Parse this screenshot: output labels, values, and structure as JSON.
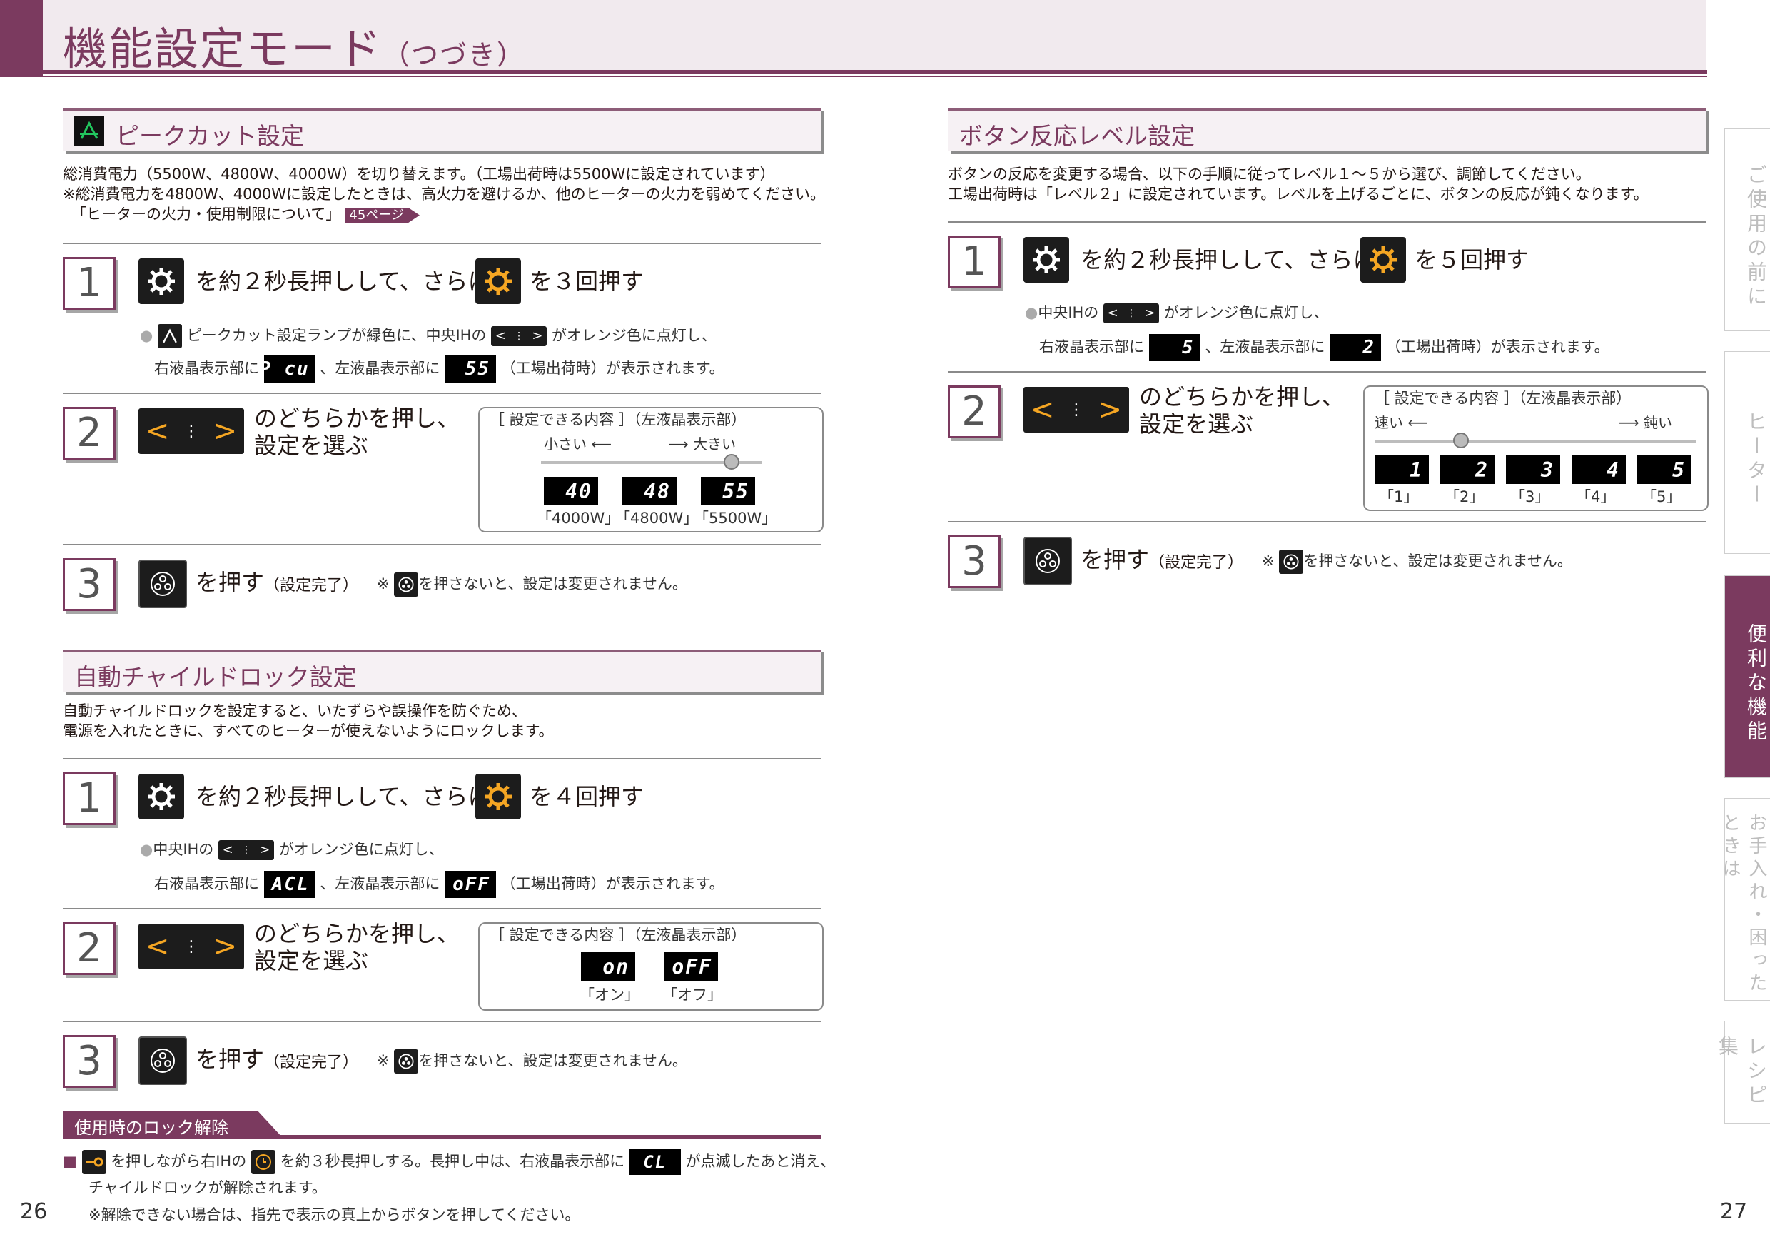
{
  "header": {
    "title": "機能設定モード",
    "title_suffix": "（つづき）"
  },
  "left": {
    "peak": {
      "title": "ピークカット設定",
      "desc": [
        "総消費電力（5500W、4800W、4000W）を切り替えます。（工場出荷時は5500Wに設定されています）",
        "※総消費電力を4800W、4000Wに設定したときは、高火力を避けるか、他のヒーターの火力を弱めてください。",
        "「ヒーターの火力・使用制限について」"
      ],
      "page_ref": "45ページ",
      "s1": {
        "num": "1",
        "a": "を約２秒長押しして、さらに",
        "b": "を３回押す",
        "note1a": "ピークカット設定ランプが緑色に、中央IHの",
        "note1b": "がオレンジ色に点灯し、",
        "note2a": "右液晶表示部に",
        "lcd_r": "P cu",
        "note2b": "、左液晶表示部に",
        "lcd_l": "55",
        "note2c": "（工場出荷時）が表示されます。"
      },
      "s2": {
        "num": "2",
        "text1": "のどちらかを押し、",
        "text2": "設定を選ぶ",
        "box_title": "［ 設定できる内容 ］（左液晶表示部）",
        "small": "小さい",
        "large": "大きい",
        "options": [
          "40",
          "48",
          "55"
        ],
        "labels": [
          "「4000W」",
          "「4800W」",
          "「5500W」"
        ]
      },
      "s3": {
        "num": "3",
        "text": "を押す",
        "small": "（設定完了）",
        "note": "を押さないと、設定は変更されません。",
        "mark": "※"
      }
    },
    "child": {
      "title": "自動チャイルドロック設定",
      "desc": [
        "自動チャイルドロックを設定すると、いたずらや誤操作を防ぐため、",
        "電源を入れたときに、すべてのヒーターが使えないようにロックします。"
      ],
      "s1": {
        "num": "1",
        "a": "を約２秒長押しして、さらに",
        "b": "を４回押す",
        "note1a": "中央IHの",
        "note1b": "がオレンジ色に点灯し、",
        "note2a": "右液晶表示部に",
        "lcd_r": "ACL",
        "note2b": "、左液晶表示部に",
        "lcd_l": "oFF",
        "note2c": "（工場出荷時）が表示されます。"
      },
      "s2": {
        "num": "2",
        "text1": "のどちらかを押し、",
        "text2": "設定を選ぶ",
        "box_title": "［ 設定できる内容 ］（左液晶表示部）",
        "options": [
          "on",
          "oFF"
        ],
        "labels": [
          "「オン」",
          "「オフ」"
        ]
      },
      "s3": {
        "num": "3",
        "text": "を押す",
        "small": "（設定完了）",
        "note": "を押さないと、設定は変更されません。",
        "mark": "※"
      },
      "unlock": {
        "title": "使用時のロック解除",
        "line1a": "を押しながら右IHの",
        "line1b": "を約３秒長押しする。長押し中は、右液晶表示部に",
        "lcd": "CL",
        "line1c": "が点滅したあと消え、",
        "line2": "チャイルドロックが解除されます。",
        "line3": "※解除できない場合は、指先で表示の真上からボタンを押してください。"
      }
    },
    "page_num": "26"
  },
  "right": {
    "button": {
      "title": "ボタン反応レベル設定",
      "desc": [
        "ボタンの反応を変更する場合、以下の手順に従ってレベル１～５から選び、調節してください。",
        "工場出荷時は「レベル２」に設定されています。レベルを上げるごとに、ボタンの反応が鈍くなります。"
      ],
      "s1": {
        "num": "1",
        "a": "を約２秒長押しして、さらに",
        "b": "を５回押す",
        "note1a": "中央IHの",
        "note1b": "がオレンジ色に点灯し、",
        "note2a": "右液晶表示部に",
        "lcd_r": "5",
        "note2b": "、左液晶表示部に",
        "lcd_l": "2",
        "note2c": "（工場出荷時）が表示されます。"
      },
      "s2": {
        "num": "2",
        "text1": "のどちらかを押し、",
        "text2": "設定を選ぶ",
        "box_title": "［ 設定できる内容 ］（左液晶表示部）",
        "fast": "速い",
        "slow": "鈍い",
        "options": [
          "1",
          "2",
          "3",
          "4",
          "5"
        ],
        "labels": [
          "「1」",
          "「2」",
          "「3」",
          "「4」",
          "「5」"
        ]
      },
      "s3": {
        "num": "3",
        "text": "を押す",
        "small": "（設定完了）",
        "note": "を押さないと、設定は変更されません。",
        "mark": "※"
      }
    },
    "page_num": "27"
  },
  "side_tabs": [
    "ご使用の前に",
    "ヒーター",
    "便利な機能",
    "お手入れ・困ったときは",
    "レシピ集"
  ],
  "colors": {
    "accent": "#7b3a5f",
    "orange": "#f5a623",
    "peak_green": "#22c55e"
  }
}
